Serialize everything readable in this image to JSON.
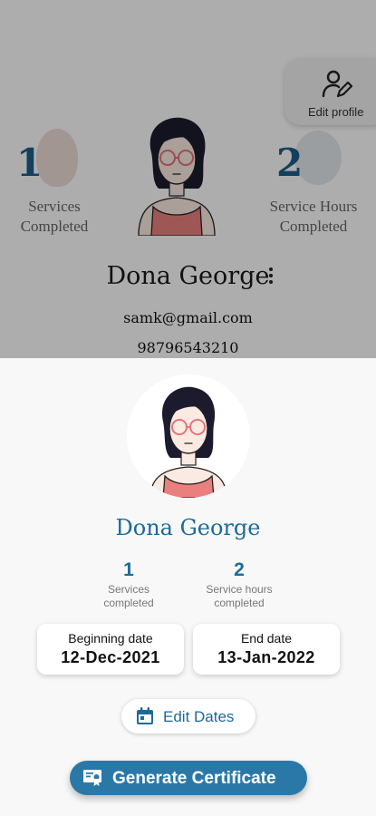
{
  "background_profile": {
    "edit_profile_label": "Edit profile",
    "services_count": "1",
    "services_label_line1": "Services",
    "services_label_line2": "Completed",
    "hours_count": "2",
    "hours_label_line1": "Service Hours",
    "hours_label_line2": "Completed",
    "name": "Dona George",
    "email": "samk@gmail.com",
    "phone": "98796543210"
  },
  "sheet": {
    "name": "Dona George",
    "services_count": "1",
    "services_label_line1": "Services",
    "services_label_line2": "completed",
    "hours_count": "2",
    "hours_label_line1": "Service hours",
    "hours_label_line2": "completed",
    "beginning_label": "Beginning date",
    "beginning_value": "12-Dec-2021",
    "end_label": "End date",
    "end_value": "13-Jan-2022",
    "edit_dates_label": "Edit Dates",
    "generate_label": "Generate Certificate"
  },
  "icons": {
    "edit_profile": "user-edit-icon",
    "more": "more-vertical-icon",
    "calendar": "calendar-icon",
    "certificate": "certificate-icon"
  },
  "colors": {
    "accent": "#1d6a96",
    "button_primary": "#2a78a8",
    "scrim": "rgba(0,0,0,0.32)"
  }
}
